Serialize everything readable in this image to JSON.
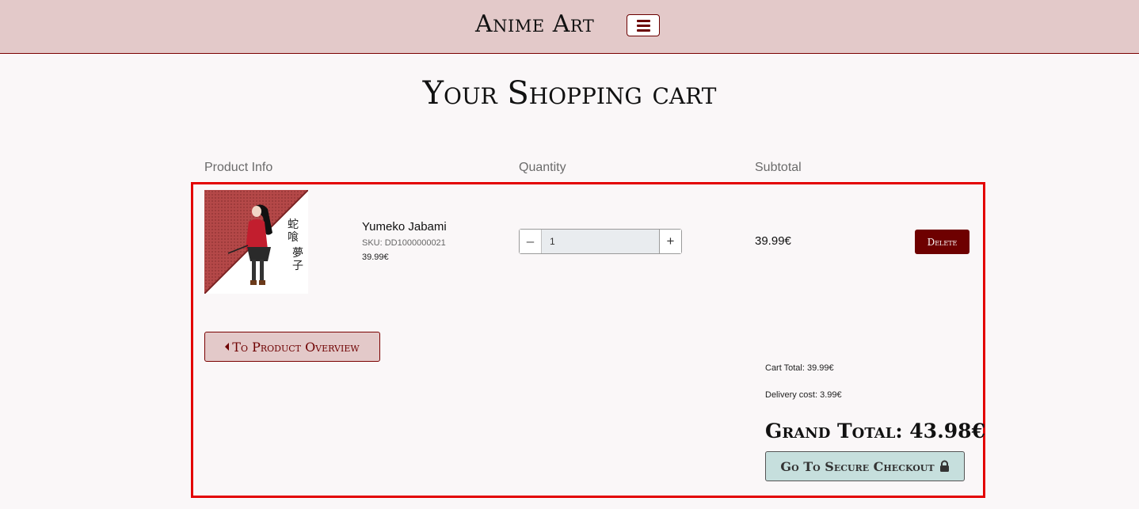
{
  "header": {
    "brand": "Anime Art",
    "menu_icon": "hamburger-icon",
    "bg_color": "#e3c9c9",
    "accent_color": "#6e0000"
  },
  "page": {
    "title": "Your Shopping cart"
  },
  "table": {
    "headers": [
      "Product Info",
      "Quantity",
      "Subtotal"
    ]
  },
  "cart_item": {
    "name": "Yumeko Jabami",
    "sku": "SKU: DD1000000021",
    "price": "39.99€",
    "quantity": "1",
    "subtotal": "39.99€",
    "delete_label": "Delete",
    "image_text": "蛇喰 夢子"
  },
  "actions": {
    "overview_label": "To Product Overview",
    "checkout_label": "Go To Secure Checkout"
  },
  "totals": {
    "cart_total": "Cart Total: 39.99€",
    "delivery": "Delivery cost: 3.99€",
    "grand_total": "Grand Total: 43.98€"
  }
}
